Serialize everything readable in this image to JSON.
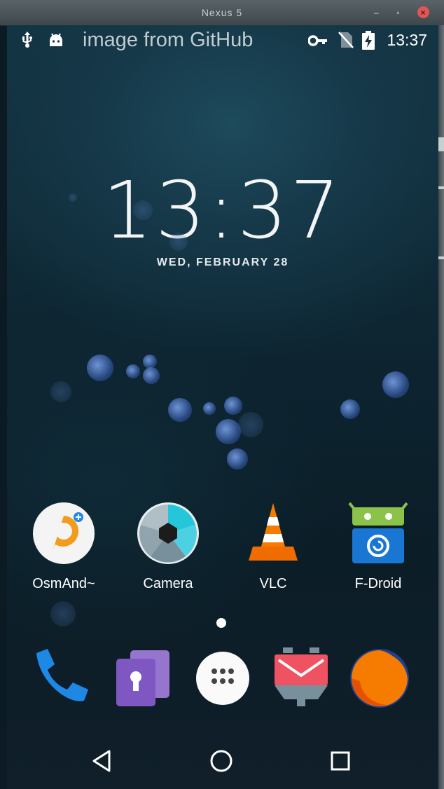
{
  "window": {
    "title": "Nexus 5",
    "minimize_label": "–",
    "maximize_label": "▫",
    "close_label": "×"
  },
  "status_bar": {
    "time": "13:37"
  },
  "watermark": "image from GitHub",
  "lockclock": {
    "time": "13:37",
    "date": "WED, FEBRUARY 28"
  },
  "apps": [
    {
      "label": "OsmAnd~",
      "icon": "osmand-icon"
    },
    {
      "label": "Camera",
      "icon": "camera-icon"
    },
    {
      "label": "VLC",
      "icon": "vlc-icon"
    },
    {
      "label": "F-Droid",
      "icon": "fdroid-icon"
    }
  ],
  "dock": [
    {
      "icon": "phone-icon"
    },
    {
      "icon": "vault-lock-icon"
    },
    {
      "icon": "app-drawer-icon"
    },
    {
      "icon": "mail-icon"
    },
    {
      "icon": "firefox-icon"
    }
  ],
  "nav": [
    {
      "icon": "back-icon"
    },
    {
      "icon": "home-icon"
    },
    {
      "icon": "recents-icon"
    }
  ],
  "colors": {
    "accent": "#1e88e5",
    "vlc_orange": "#f57c00",
    "fdroid_green": "#8bc34a"
  }
}
